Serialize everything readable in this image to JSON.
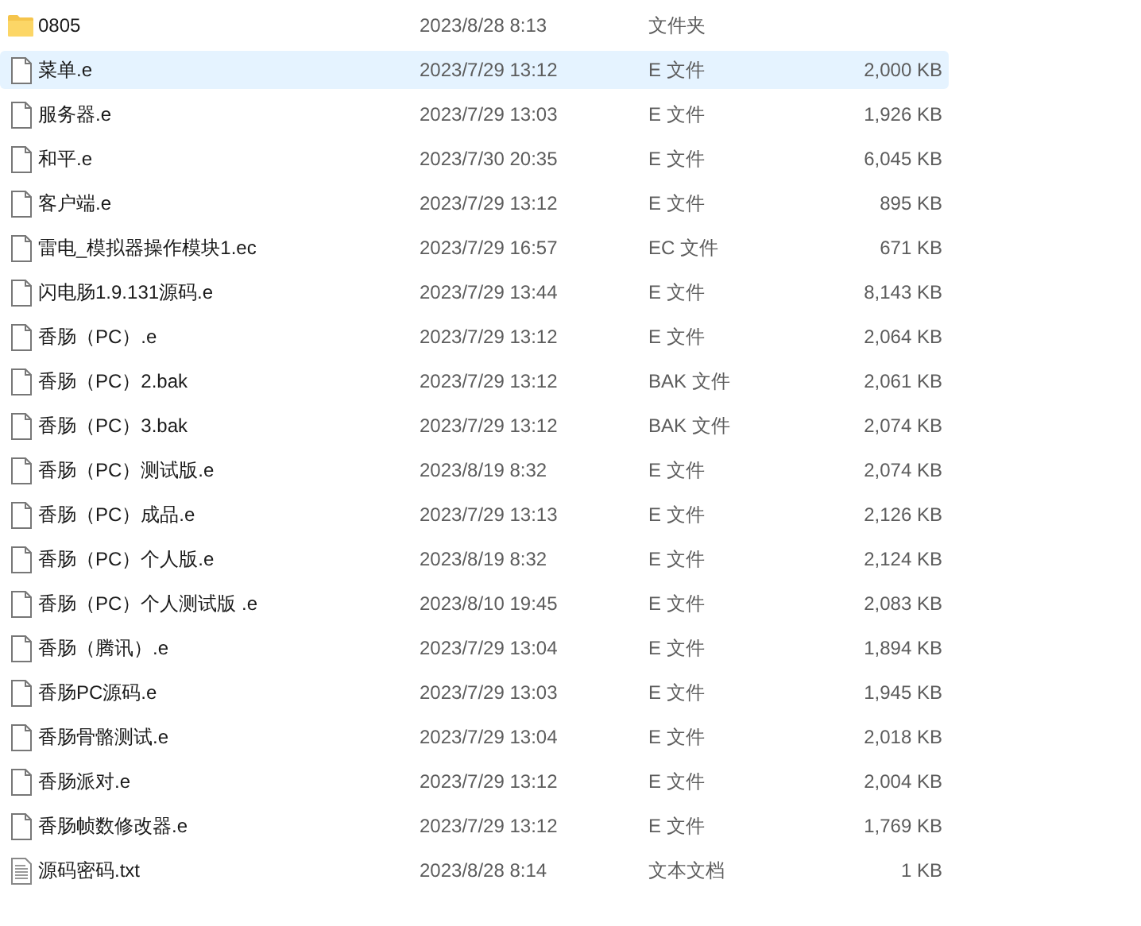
{
  "files": [
    {
      "kind": "folder",
      "name": "0805",
      "modified": "2023/8/28 8:13",
      "type": "文件夹",
      "selected": false
    },
    {
      "kind": "file",
      "name": "菜单.e",
      "modified": "2023/7/29 13:12",
      "type": "E 文件",
      "size": "2,000 KB",
      "selected": true
    },
    {
      "kind": "file",
      "name": "服务器.e",
      "modified": "2023/7/29 13:03",
      "type": "E 文件",
      "size": "1,926 KB",
      "selected": false
    },
    {
      "kind": "file",
      "name": "和平.e",
      "modified": "2023/7/30 20:35",
      "type": "E 文件",
      "size": "6,045 KB",
      "selected": false
    },
    {
      "kind": "file",
      "name": "客户端.e",
      "modified": "2023/7/29 13:12",
      "type": "E 文件",
      "size": "895 KB",
      "selected": false
    },
    {
      "kind": "file",
      "name": "雷电_模拟器操作模块1.ec",
      "modified": "2023/7/29 16:57",
      "type": "EC 文件",
      "size": "671 KB",
      "selected": false
    },
    {
      "kind": "file",
      "name": "闪电肠1.9.131源码.e",
      "modified": "2023/7/29 13:44",
      "type": "E 文件",
      "size": "8,143 KB",
      "selected": false
    },
    {
      "kind": "file",
      "name": "香肠（PC）.e",
      "modified": "2023/7/29 13:12",
      "type": "E 文件",
      "size": "2,064 KB",
      "selected": false
    },
    {
      "kind": "file",
      "name": "香肠（PC）2.bak",
      "modified": "2023/7/29 13:12",
      "type": "BAK 文件",
      "size": "2,061 KB",
      "selected": false
    },
    {
      "kind": "file",
      "name": "香肠（PC）3.bak",
      "modified": "2023/7/29 13:12",
      "type": "BAK 文件",
      "size": "2,074 KB",
      "selected": false
    },
    {
      "kind": "file",
      "name": "香肠（PC）测试版.e",
      "modified": "2023/8/19 8:32",
      "type": "E 文件",
      "size": "2,074 KB",
      "selected": false
    },
    {
      "kind": "file",
      "name": "香肠（PC）成品.e",
      "modified": "2023/7/29 13:13",
      "type": "E 文件",
      "size": "2,126 KB",
      "selected": false
    },
    {
      "kind": "file",
      "name": "香肠（PC）个人版.e",
      "modified": "2023/8/19 8:32",
      "type": "E 文件",
      "size": "2,124 KB",
      "selected": false
    },
    {
      "kind": "file",
      "name": "香肠（PC）个人测试版 .e",
      "modified": "2023/8/10 19:45",
      "type": "E 文件",
      "size": "2,083 KB",
      "selected": false
    },
    {
      "kind": "file",
      "name": "香肠（腾讯）.e",
      "modified": "2023/7/29 13:04",
      "type": "E 文件",
      "size": "1,894 KB",
      "selected": false
    },
    {
      "kind": "file",
      "name": "香肠PC源码.e",
      "modified": "2023/7/29 13:03",
      "type": "E 文件",
      "size": "1,945 KB",
      "selected": false
    },
    {
      "kind": "file",
      "name": "香肠骨骼测试.e",
      "modified": "2023/7/29 13:04",
      "type": "E 文件",
      "size": "2,018 KB",
      "selected": false
    },
    {
      "kind": "file",
      "name": "香肠派对.e",
      "modified": "2023/7/29 13:12",
      "type": "E 文件",
      "size": "2,004 KB",
      "selected": false
    },
    {
      "kind": "file",
      "name": "香肠帧数修改器.e",
      "modified": "2023/7/29 13:12",
      "type": "E 文件",
      "size": "1,769 KB",
      "selected": false
    },
    {
      "kind": "text",
      "name": "源码密码.txt",
      "modified": "2023/8/28 8:14",
      "type": "文本文档",
      "size": "1 KB",
      "selected": false
    }
  ]
}
